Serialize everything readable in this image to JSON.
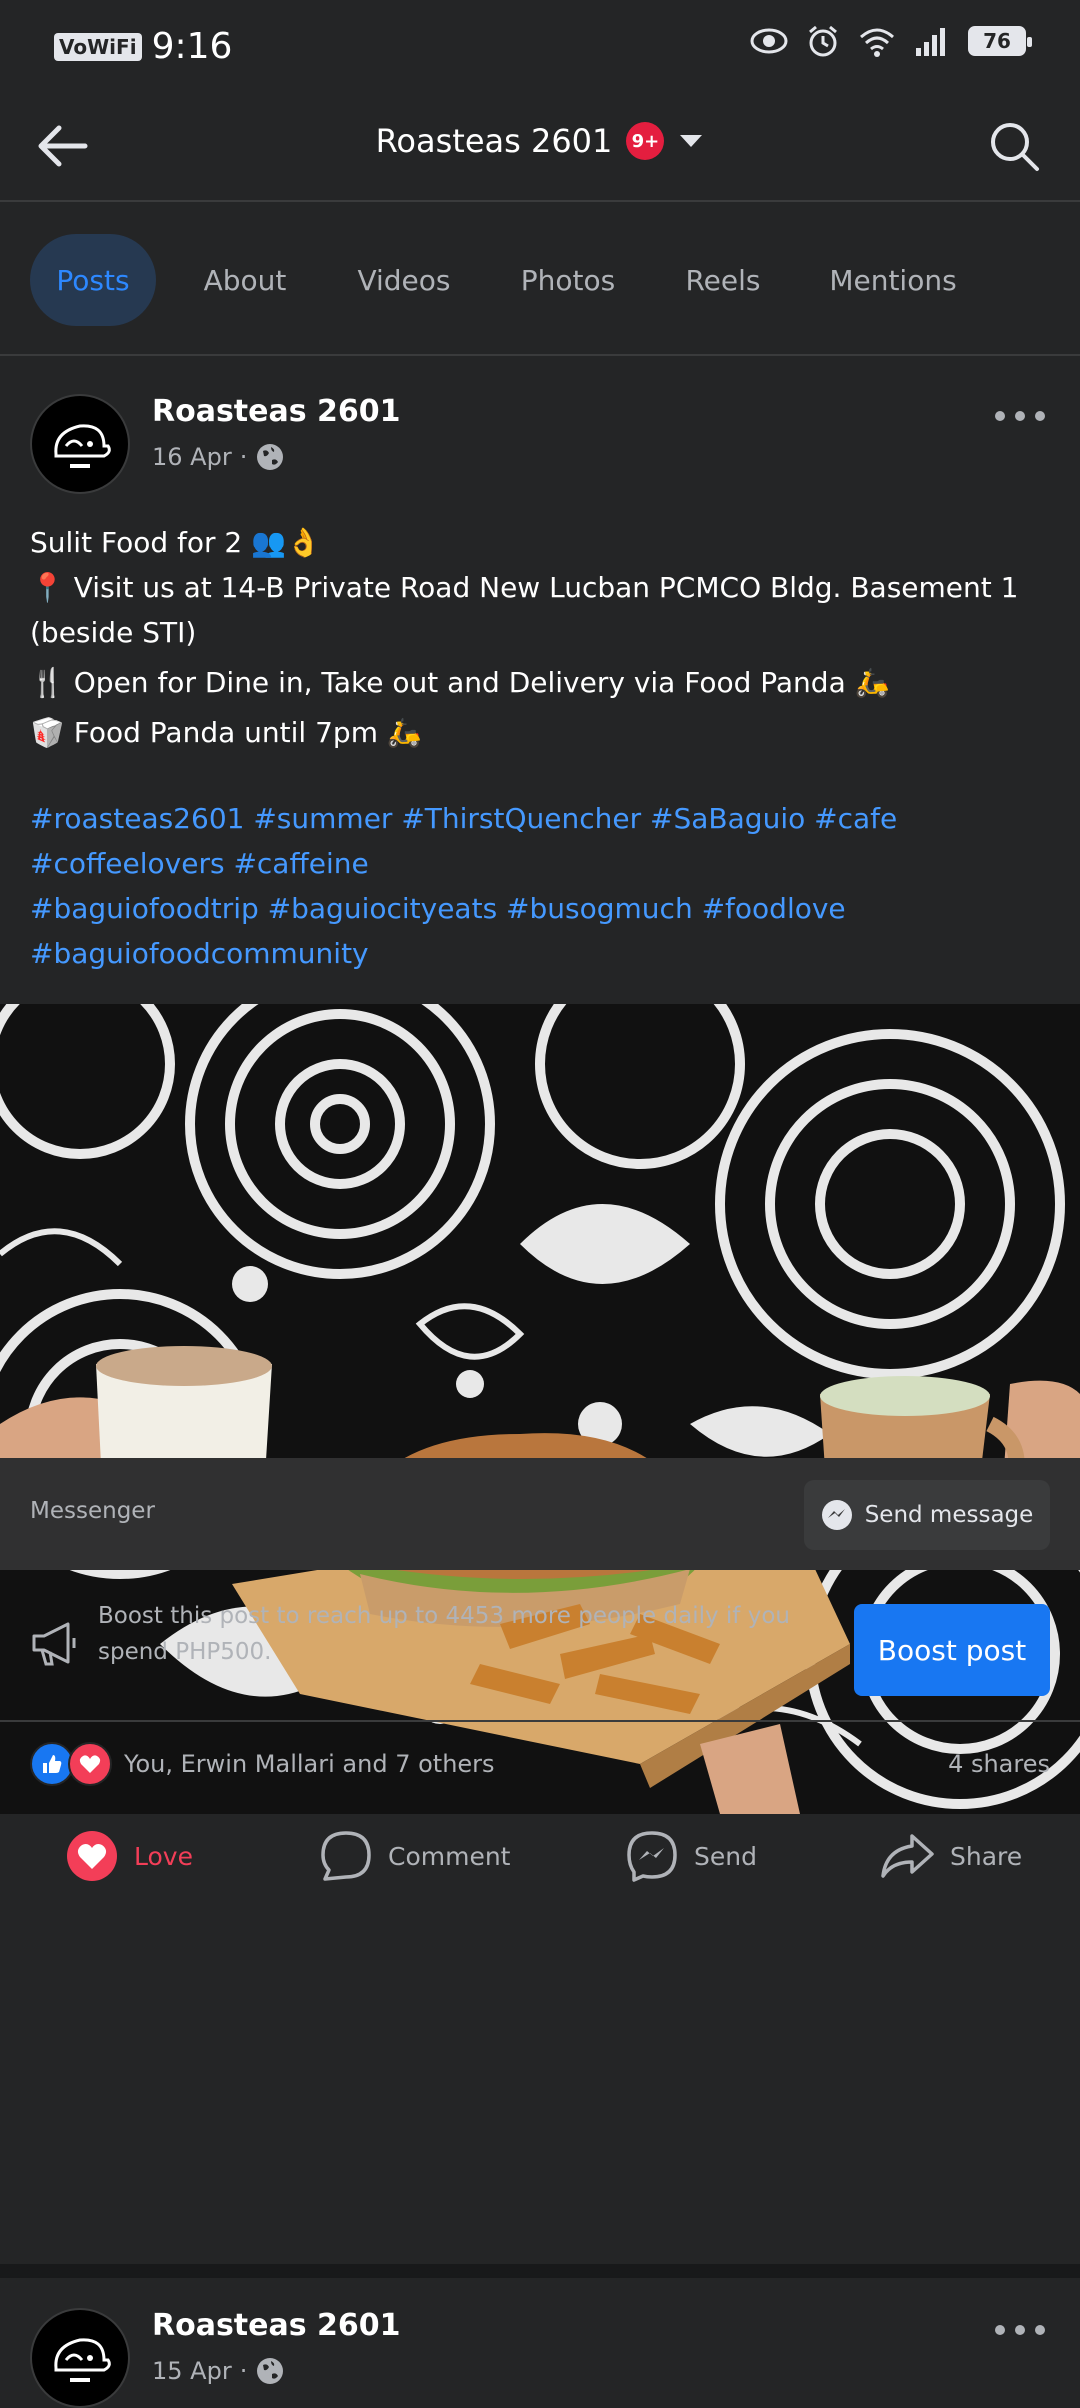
{
  "status_bar": {
    "vowifi": "VoWiFi",
    "time": "9:16",
    "battery": "76"
  },
  "header": {
    "page_title": "Roasteas 2601",
    "notification_badge": "9+"
  },
  "tabs": [
    {
      "label": "Posts",
      "active": true
    },
    {
      "label": "About",
      "active": false
    },
    {
      "label": "Videos",
      "active": false
    },
    {
      "label": "Photos",
      "active": false
    },
    {
      "label": "Reels",
      "active": false
    },
    {
      "label": "Mentions",
      "active": false
    }
  ],
  "post": {
    "author": "Roasteas 2601",
    "date": "16 Apr",
    "separator": "·",
    "caption_lines": [
      "Sulit Food for 2 👥👌",
      "📍 Visit us at 14-B Private Road New Lucban PCMCO Bldg. Basement 1 (beside STI)",
      "🍴 Open for Dine in, Take out and Delivery via Food Panda 🛵",
      "🥡 Food Panda until 7pm 🛵"
    ],
    "hashtag_lines": [
      "#roasteas2601 #summer  #ThirstQuencher #SaBaguio #cafe #coffeelovers #caffeine",
      "#baguiofoodtrip #baguiocityeats #busogmuch #foodlove",
      "#baguiofoodcommunity"
    ],
    "messenger_label": "Messenger",
    "send_message_label": "Send message",
    "boost_text": "Boost this post to reach up to 4453 more people daily if you spend PHP500.",
    "boost_button": "Boost post",
    "reaction_names": "You, Erwin Mallari and 7 others",
    "shares": "4 shares",
    "actions": {
      "love": "Love",
      "comment": "Comment",
      "send": "Send",
      "share": "Share"
    }
  },
  "next_post": {
    "author": "Roasteas 2601",
    "date": "15 Apr",
    "separator": "·"
  },
  "colors": {
    "background": "#242526",
    "accent_blue": "#1877f2",
    "hashtag_blue": "#4599ff",
    "love_red": "#f33e58",
    "badge_red": "#e41e3f"
  }
}
